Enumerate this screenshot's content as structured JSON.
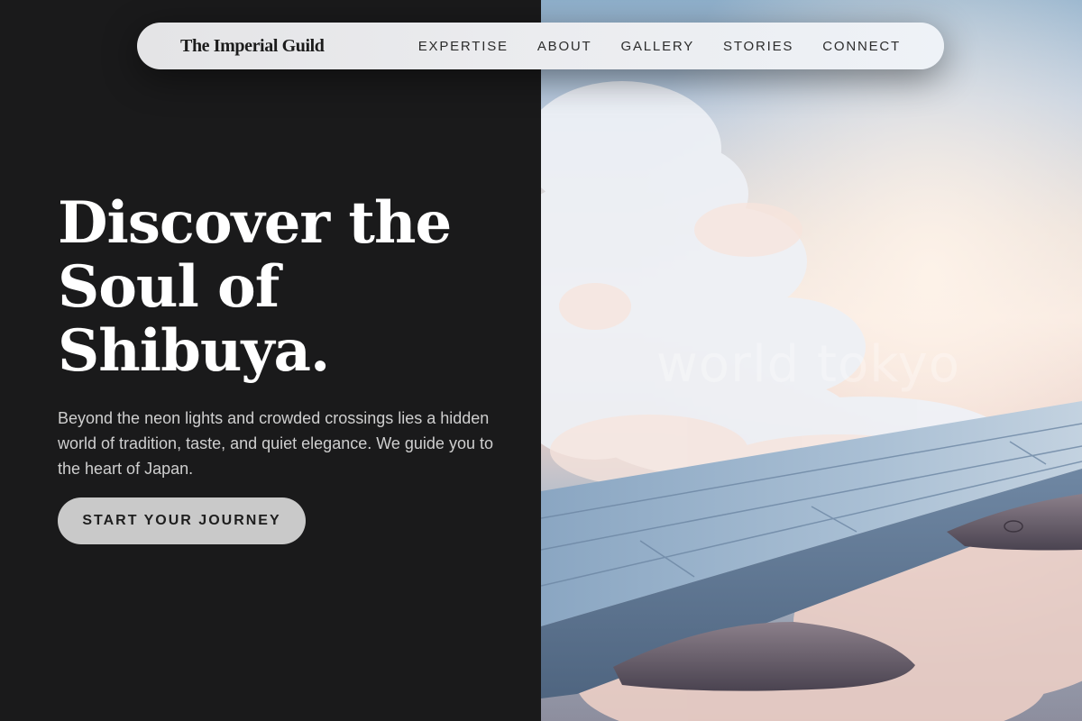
{
  "navbar": {
    "brand": "The Imperial Guild",
    "links": [
      "EXPERTISE",
      "ABOUT",
      "GALLERY",
      "STORIES",
      "CONNECT"
    ]
  },
  "hero": {
    "title_lines": [
      "Discover the",
      "Soul of",
      "Shibuya."
    ],
    "description": "Beyond the neon lights and crowded crossings lies a hidden world of tradition, taste, and quiet elegance. We guide you to the heart of Japan.",
    "cta_label": "START YOUR JOURNEY"
  },
  "image": {
    "watermark": "world tokyo"
  },
  "colors": {
    "background": "#1a1a1b",
    "navbar": "#e9eaed",
    "cta": "#c9c9c9",
    "title": "#ffffff",
    "body_text": "#cfcfcf"
  }
}
